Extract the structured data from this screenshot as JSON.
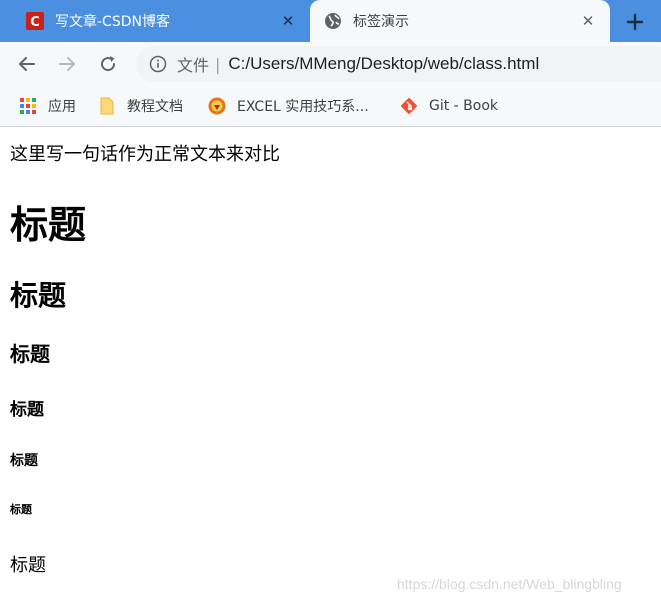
{
  "tabs": [
    {
      "title": "写文章-CSDN博客",
      "favicon": "csdn-logo-icon",
      "favicon_letter": "C",
      "active": false
    },
    {
      "title": "标签演示",
      "favicon": "globe-icon",
      "active": true
    }
  ],
  "toolbar": {
    "scheme_label": "文件",
    "separator": "|",
    "url": "C:/Users/MMeng/Desktop/web/class.html"
  },
  "bookmarks": [
    {
      "label": "应用",
      "icon": "apps-grid-icon"
    },
    {
      "label": "教程文档",
      "icon": "folder-icon"
    },
    {
      "label": "EXCEL 实用技巧系...",
      "icon": "excel-lion-icon"
    },
    {
      "label": "Git - Book",
      "icon": "git-icon"
    }
  ],
  "content": {
    "normal_text": "这里写一句话作为正常文本来对比",
    "headings": [
      "标题",
      "标题",
      "标题",
      "标题",
      "标题",
      "标题"
    ],
    "paragraph": "标题"
  },
  "watermark": "https://blog.csdn.net/Web_blingbling",
  "colors": {
    "tab_strip": "#4a8fe0",
    "toolbar": "#f7f8fa",
    "csdn_red": "#c9201a",
    "git_orange": "#f05133"
  }
}
